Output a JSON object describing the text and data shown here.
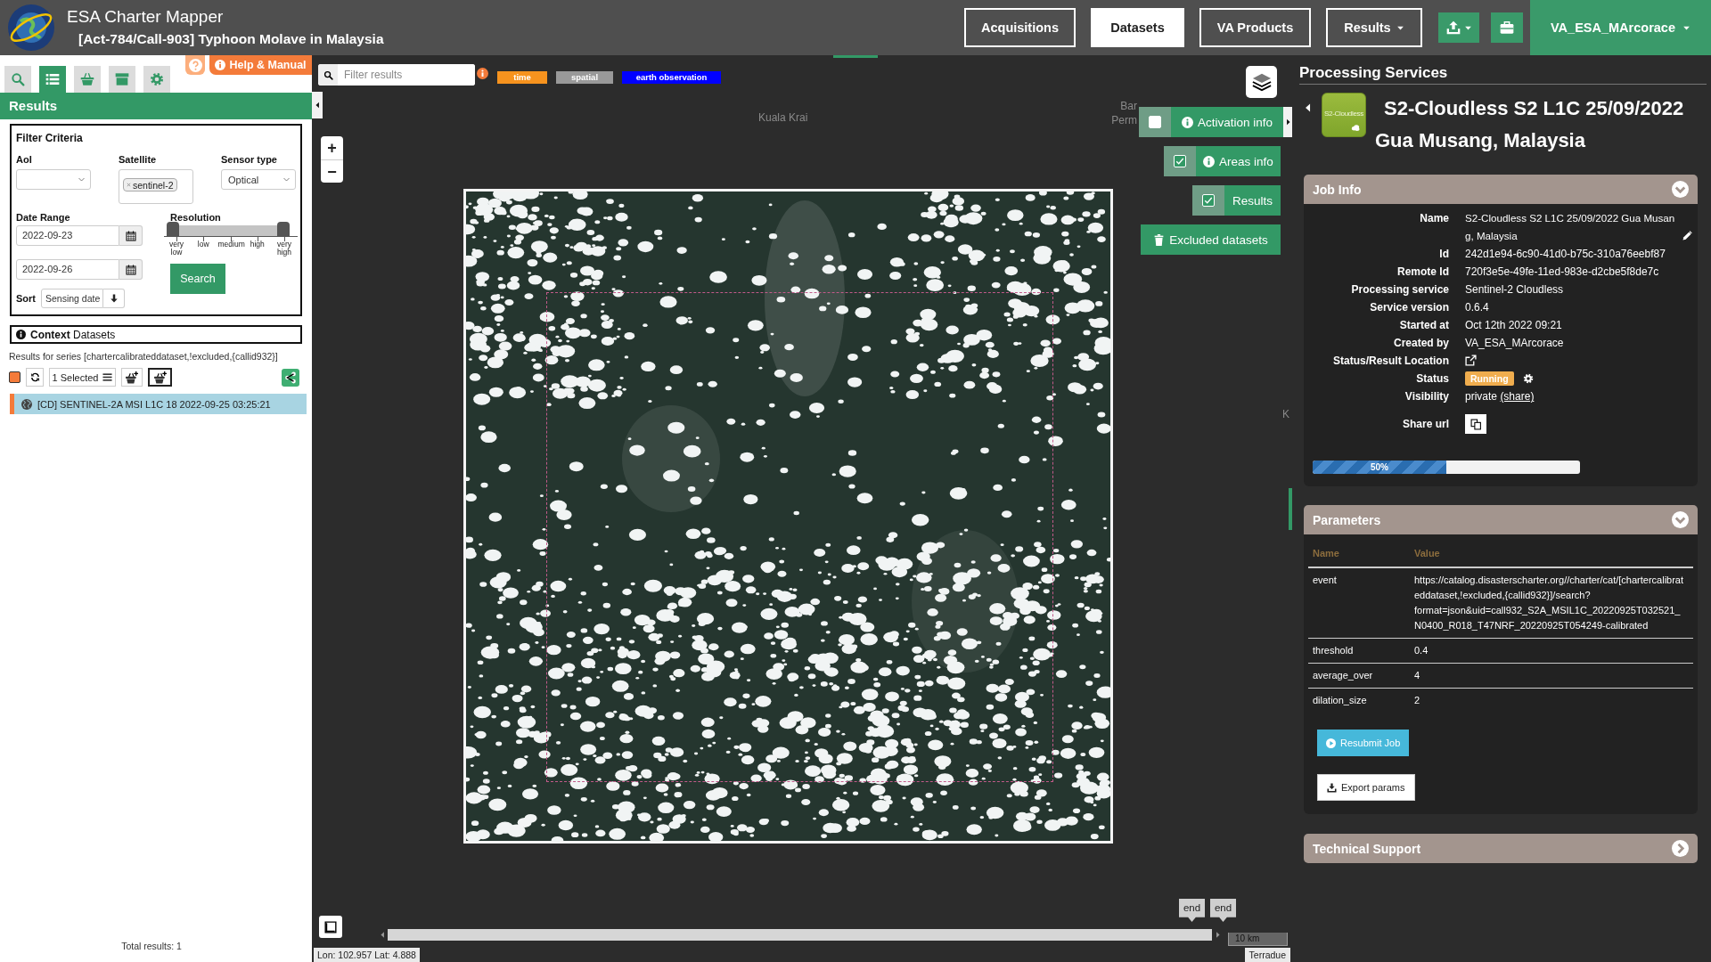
{
  "header": {
    "title": "ESA Charter Mapper",
    "subtitle": "[Act-784/Call-903] Typhoon Molave in Malaysia",
    "nav": [
      {
        "label": "Acquisitions",
        "kind": "tab",
        "selected": false
      },
      {
        "label": "Datasets",
        "kind": "tab",
        "selected": true
      },
      {
        "label": "VA Products",
        "kind": "tab",
        "selected": false
      },
      {
        "label": "Results",
        "kind": "menu",
        "selected": false
      }
    ],
    "tools": [
      {
        "kind": "upload"
      },
      {
        "kind": "briefcase"
      }
    ],
    "user": {
      "name": "VA_ESA_MArcorace"
    }
  },
  "sidebar": {
    "tabs": [
      {
        "kind": "search",
        "selected": false
      },
      {
        "kind": "list",
        "selected": true
      },
      {
        "kind": "basket",
        "selected": false
      },
      {
        "kind": "archive",
        "selected": false
      },
      {
        "kind": "settings",
        "selected": false
      }
    ],
    "help_button": "Help & Manual",
    "section_title": "Results",
    "filter": {
      "title": "Filter Criteria",
      "aoi": {
        "label": "AoI"
      },
      "satellite": {
        "label": "Satellite",
        "chips": [
          "sentinel-2"
        ]
      },
      "sensor": {
        "label": "Sensor type",
        "value": "Optical"
      },
      "date_range": {
        "label": "Date Range",
        "from": "2022-09-23",
        "to": "2022-09-26"
      },
      "resolution": {
        "label": "Resolution",
        "ticks": [
          "very low",
          "low",
          "medium",
          "high",
          "very high"
        ],
        "handles": [
          {
            "level": 0
          },
          {
            "level": 1
          }
        ]
      },
      "search_button": "Search",
      "sort": {
        "label": "Sort",
        "value": "Sensing date"
      }
    },
    "context": {
      "title": "**Context** Datasets"
    },
    "series": "Results for series [chartercalibrateddataset,!excluded,{callid932}]",
    "select_all": {
      "checked": true
    },
    "selection": "1 Selected",
    "results": [
      {
        "label": "[CD] SENTINEL-2A MSI L1C 18 2022-09-25 03:25:21",
        "selected": true
      }
    ],
    "total": "Total results: 1"
  },
  "map": {
    "filter": {
      "placeholder": "Filter results"
    },
    "tags": [
      {
        "label": "time",
        "color": "#f7931e"
      },
      {
        "label": "spatial",
        "color": "#999999"
      },
      {
        "label": "earth observation",
        "color": "#0000ff"
      }
    ],
    "place_labels": [
      "Kuala Krai",
      "Bar",
      "Perm",
      "K"
    ],
    "zoom": [
      "+",
      "−"
    ],
    "layers": [
      {
        "label": "Activation info",
        "kind": "info",
        "checked": false
      },
      {
        "label": "Areas info",
        "kind": "info",
        "checked": true
      },
      {
        "label": "Results",
        "kind": "plain",
        "checked": true
      }
    ],
    "excluded_button": "Excluded datasets",
    "timeline": {
      "handles": [
        "end",
        "end"
      ]
    },
    "scale": "10 km",
    "coordinates": "Lon: 102.957 Lat: 4.888",
    "attribution": "Terradue"
  },
  "processing": {
    "title": "Processing Services",
    "service_label": "S2-Cloudless",
    "job_title": "S2-Cloudless S2 L1C 25/09/2022 Gua Musang, Malaysia",
    "job_info": {
      "title": "Job Info",
      "expanded": true,
      "rows": [
        {
          "label": "Name",
          "kind": "editable",
          "value": "S2-Cloudless S2 L1C 25/09/2022 Gua Musang, Malaysia"
        },
        {
          "label": "Id",
          "kind": "text",
          "value": "242d1e94-6c90-41d0-b75c-310a76eebf87"
        },
        {
          "label": "Remote Id",
          "kind": "text",
          "value": "720f3e5e-49fe-11ed-983e-d2cbe5f8de7c"
        },
        {
          "label": "Processing service",
          "kind": "text",
          "value": "Sentinel-2 Cloudless"
        },
        {
          "label": "Service version",
          "kind": "text",
          "value": "0.6.4"
        },
        {
          "label": "Started at",
          "kind": "text",
          "value": "Oct 12th 2022 09:21"
        },
        {
          "label": "Created by",
          "kind": "text",
          "value": "VA_ESA_MArcorace"
        },
        {
          "label": "Status/Result Location",
          "kind": "link"
        },
        {
          "label": "Status",
          "kind": "status",
          "value": "Running"
        },
        {
          "label": "Visibility",
          "kind": "visibility",
          "value": "private",
          "link": "(share)"
        },
        {
          "label": "Share url",
          "kind": "copy"
        }
      ],
      "progress": {
        "level": 0.5,
        "label": "50%"
      }
    },
    "parameters": {
      "title": "Parameters",
      "expanded": true,
      "columns": [
        "Name",
        "Value"
      ],
      "rows": [
        {
          "name": "event",
          "value": "https://catalog.disasterscharter.org//charter/cat/[chartercalibrateddataset,!excluded,{callid932}]/search?format=json&uid=call932_S2A_MSIL1C_20220925T032521_N0400_R018_T47NRF_20220925T054249-calibrated"
        },
        {
          "name": "threshold",
          "value": "0.4"
        },
        {
          "name": "average_over",
          "value": "4"
        },
        {
          "name": "dilation_size",
          "value": "2"
        }
      ]
    },
    "actions": [
      {
        "label": "Resubmit Job",
        "kind": "resubmit"
      },
      {
        "label": "Export params",
        "kind": "export"
      }
    ],
    "support": {
      "title": "Technical Support",
      "expanded": false
    }
  }
}
